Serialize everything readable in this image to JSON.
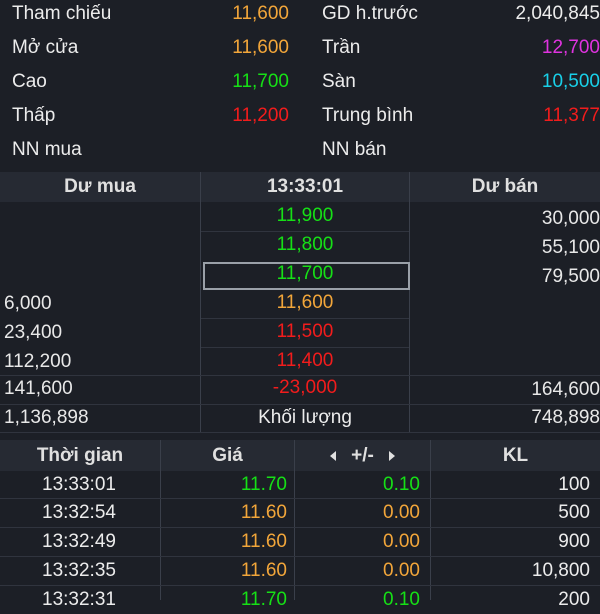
{
  "summary": [
    {
      "label1": "Tham chiếu",
      "value1": "11,600",
      "color1": "#f2a63a",
      "label2": "GD h.trước",
      "value2": "2,040,845",
      "color2": "#ececec"
    },
    {
      "label1": "Mở cửa",
      "value1": "11,600",
      "color1": "#f2a63a",
      "label2": "Trần",
      "value2": "12,700",
      "color2": "#e033e0"
    },
    {
      "label1": "Cao",
      "value1": "11,700",
      "color1": "#16e016",
      "label2": "Sàn",
      "value2": "10,500",
      "color2": "#19d0e8"
    },
    {
      "label1": "Thấp",
      "value1": "11,200",
      "color1": "#f21c1c",
      "label2": "Trung bình",
      "value2": "11,377",
      "color2": "#f21c1c"
    },
    {
      "label1": "NN mua",
      "value1": "",
      "color1": "#ececec",
      "label2": "NN bán",
      "value2": "",
      "color2": "#ececec"
    }
  ],
  "depth": {
    "header": {
      "buy": "Dư mua",
      "time": "13:33:01",
      "sell": "Dư bán"
    },
    "rows": [
      {
        "buy": "",
        "price": "11,900",
        "price_color": "#16e016",
        "sell": "30,000"
      },
      {
        "buy": "",
        "price": "11,800",
        "price_color": "#16e016",
        "sell": "55,100"
      },
      {
        "buy": "",
        "price": "11,700",
        "price_color": "#16e016",
        "sell": "79,500"
      },
      {
        "buy": "6,000",
        "price": "11,600",
        "price_color": "#f2a63a",
        "sell": ""
      },
      {
        "buy": "23,400",
        "price": "11,500",
        "price_color": "#f21c1c",
        "sell": ""
      },
      {
        "buy": "112,200",
        "price": "11,400",
        "price_color": "#f21c1c",
        "sell": ""
      },
      {
        "buy": "141,600",
        "price": "-23,000",
        "price_color": "#f21c1c",
        "sell": "164,600"
      },
      {
        "buy": "1,136,898",
        "price": "Khối lượng",
        "price_color": "#ececec",
        "sell": "748,898"
      }
    ]
  },
  "trades": {
    "header": {
      "time": "Thời gian",
      "price": "Giá",
      "change": "+/-",
      "volume": "KL"
    },
    "rows": [
      {
        "time": "13:33:01",
        "price": "11.70",
        "price_color": "#16e016",
        "change": "0.10",
        "change_color": "#16e016",
        "volume": "100"
      },
      {
        "time": "13:32:54",
        "price": "11.60",
        "price_color": "#f2a63a",
        "change": "0.00",
        "change_color": "#f2a63a",
        "volume": "500"
      },
      {
        "time": "13:32:49",
        "price": "11.60",
        "price_color": "#f2a63a",
        "change": "0.00",
        "change_color": "#f2a63a",
        "volume": "900"
      },
      {
        "time": "13:32:35",
        "price": "11.60",
        "price_color": "#f2a63a",
        "change": "0.00",
        "change_color": "#f2a63a",
        "volume": "10,800"
      },
      {
        "time": "13:32:31",
        "price": "11.70",
        "price_color": "#16e016",
        "change": "0.10",
        "change_color": "#16e016",
        "volume": "200"
      }
    ]
  }
}
